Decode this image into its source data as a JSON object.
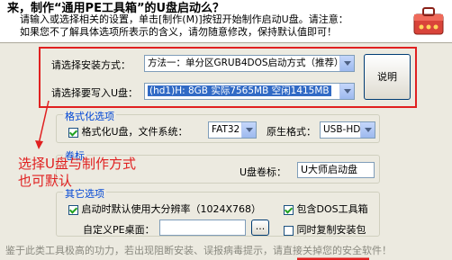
{
  "header": {
    "title": "来，制作“通用PE工具箱”的U盘启动么？",
    "line1": "请输入或选择相关的设置，单击[制作(M)]按钮开始制作启动U盘。请注意：",
    "line2": "如果您不了解具体选项所表示的含义，请勿随意修改，保持默认值即可！",
    "icon": "toolbox-icon"
  },
  "main": {
    "install_method_label": "请选择安装方式：",
    "install_method_value": "方法一：单分区GRUB4DOS启动方式（推荐）",
    "target_disk_label": "请选择要写入U盘：",
    "target_disk_value": "(hd1)H: 8GB 实际7565MB 空闲1415MB",
    "explain_button": "说明"
  },
  "format_group": {
    "title": "格式化选项",
    "format_checkbox_label": "格式化U盘，文件系统：",
    "format_checked": true,
    "filesystem_value": "FAT32",
    "original_format_label": "原生格式：",
    "original_format_value": "USB-HDD"
  },
  "name_group": {
    "title": "卷标",
    "label": "U盘卷标：",
    "value": "U大师启动盘"
  },
  "other_group": {
    "title": "其它选项",
    "resolution_label": "启动时默认使用大分辨率（1024X768）",
    "resolution_checked": true,
    "dos_tools_label": "包含DOS工具箱",
    "dos_tools_checked": true,
    "wallpaper_label": "自定义PE桌面：",
    "wallpaper_value": "",
    "browse_label": "...",
    "copy_installer_label": "同时复制安装包",
    "copy_installer_checked": false
  },
  "annotation": {
    "line1": "选择U盘与制作方式",
    "line2": "也可默认"
  },
  "footer": {
    "text": "鉴于此类工具极高的功力，若出现阻断安装、误报病毒提示，请直接关掉您的安全软件！"
  },
  "colors": {
    "highlight": "#316ac5",
    "annotation_red": "#e02020",
    "group_title_blue": "#0046d5"
  }
}
